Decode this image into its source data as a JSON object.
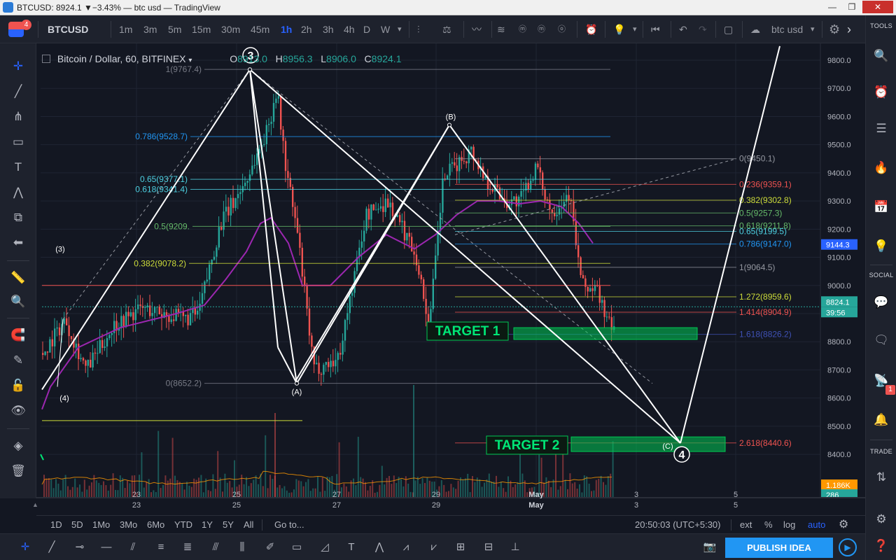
{
  "window": {
    "title": "BTCUSD: 8924.1 ▼−3.43% — btc usd — TradingView",
    "min": "—",
    "max": "❐",
    "close": "✕"
  },
  "toolbar": {
    "badge": "4",
    "symbol": "BTCUSD",
    "intervals": [
      "1m",
      "3m",
      "5m",
      "15m",
      "30m",
      "45m",
      "1h",
      "2h",
      "3h",
      "4h",
      "D",
      "W"
    ],
    "active_interval": "1h",
    "layout_name": "btc usd"
  },
  "rightpanel": {
    "tools_label": "TOOLS",
    "social_label": "SOCIAL",
    "trade_label": "TRADE",
    "notif_badge": "1"
  },
  "legend": {
    "name": "Bitcoin / Dollar, 60, BITFINEX",
    "o_label": "O",
    "o": "8913.0",
    "h_label": "H",
    "h": "8956.3",
    "l_label": "L",
    "l": "8906.0",
    "c_label": "C",
    "c": "8924.1"
  },
  "price_axis": {
    "ticks": [
      "9800.0",
      "9700.0",
      "9600.0",
      "9500.0",
      "9400.0",
      "9300.0",
      "9200.0",
      "9100.0",
      "9000.0",
      "8900.0",
      "8800.0",
      "8700.0",
      "8600.0",
      "8500.0",
      "8400.0"
    ],
    "tags": [
      {
        "text": "9144.3",
        "color": "#2962ff"
      },
      {
        "text": "8824.1",
        "color": "#26a69a"
      },
      {
        "text": "39:56",
        "color": "#26a69a"
      },
      {
        "text": "1.186K",
        "color": "#ff9800"
      },
      {
        "text": "286",
        "color": "#26a69a"
      }
    ]
  },
  "time_axis": {
    "ticks": [
      "23",
      "25",
      "27",
      "29",
      "May",
      "3",
      "5"
    ]
  },
  "fib_left": [
    {
      "text": "1(9767.4)",
      "color": "#787b86"
    },
    {
      "text": "0.786(9528.7)",
      "color": "#2196f3"
    },
    {
      "text": "0.65(9377.1)",
      "color": "#4dd0e1"
    },
    {
      "text": "0.618(9341.4)",
      "color": "#4dd0e1"
    },
    {
      "text": "0.5(9209.",
      "color": "#66bb6a"
    },
    {
      "text": "0.382(9078.2)",
      "color": "#cddc39"
    },
    {
      "text": "0(8652.2)",
      "color": "#787b86"
    }
  ],
  "fib_right": [
    {
      "text": "0(9450.1)",
      "color": "#9598a1"
    },
    {
      "text": "0.236(9359.1)",
      "color": "#ef5350"
    },
    {
      "text": "0.382(9302.8)",
      "color": "#cddc39"
    },
    {
      "text": "0.5(9257.3)",
      "color": "#66bb6a"
    },
    {
      "text": "0.618(9211.8)",
      "color": "#66bb6a"
    },
    {
      "text": "0.65(9199.5)",
      "color": "#4dd0e1"
    },
    {
      "text": "0.786(9147.0)",
      "color": "#2196f3"
    },
    {
      "text": "1(9064.5)",
      "color": "#9598a1"
    },
    {
      "text": "1.272(8959.6)",
      "color": "#cddc39"
    },
    {
      "text": "1.414(8904.9)",
      "color": "#ef5350"
    },
    {
      "text": "1.618(8826.2)",
      "color": "#3f51b5"
    },
    {
      "text": "2.618(8440.6)",
      "color": "#ef5350"
    }
  ],
  "waves": {
    "w3": "3",
    "w4": "4",
    "pA": "(A)",
    "pB": "(B)",
    "pC": "(C)",
    "p3": "(3)",
    "p4": "(4)"
  },
  "targets": {
    "t1": "TARGET 1",
    "t2": "TARGET 2"
  },
  "bottombar": {
    "ranges": [
      "1D",
      "5D",
      "1Mo",
      "3Mo",
      "6Mo",
      "YTD",
      "1Y",
      "5Y",
      "All"
    ],
    "goto": "Go to...",
    "time": "20:50:03 (UTC+5:30)",
    "ext": "ext",
    "pct": "%",
    "log": "log",
    "auto": "auto"
  },
  "drawbar": {
    "publish": "PUBLISH IDEA"
  },
  "colors": {
    "bg": "#131722",
    "panel": "#1e222d",
    "up": "#26a69a",
    "down": "#ef5350",
    "ma": "#9c27b0",
    "target": "#00c853",
    "accent": "#2962ff"
  }
}
